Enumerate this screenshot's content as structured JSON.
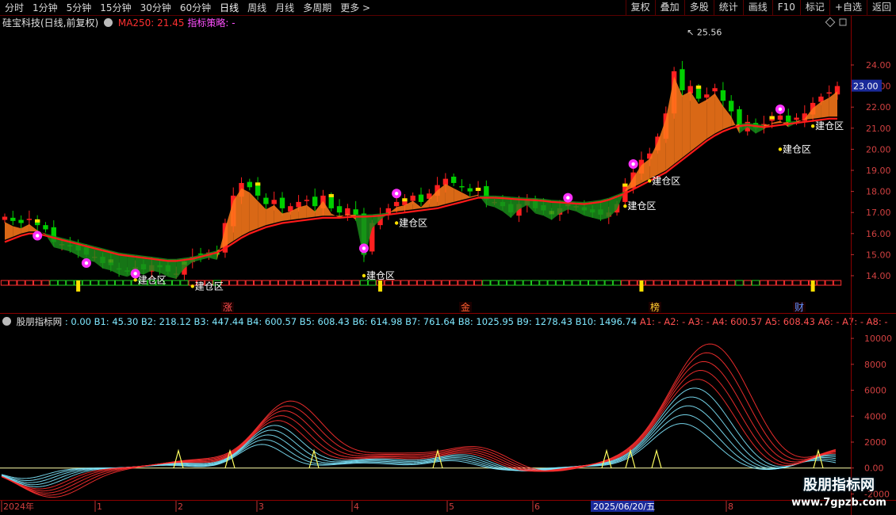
{
  "toolbar": {
    "periods": [
      "分时",
      "1分钟",
      "5分钟",
      "15分钟",
      "30分钟",
      "60分钟",
      "日线",
      "周线",
      "月线",
      "多周期",
      "更多"
    ],
    "active_period": "日线",
    "more_arrow": ">",
    "actions": [
      "复权",
      "叠加",
      "多股",
      "统计",
      "画线",
      "F10",
      "标记",
      "+自选",
      "返回"
    ]
  },
  "main_info": {
    "stock": "硅宝科技(日线,前复权)",
    "ma": "MA250: 21.45",
    "strategy": "指标策略: -"
  },
  "price_axis": {
    "ticks": [
      "24.00",
      "23.00",
      "22.00",
      "21.00",
      "20.00",
      "19.00",
      "18.00",
      "17.00",
      "16.00",
      "15.00",
      "14.00"
    ],
    "current_price": "23.00",
    "high_label": "25.56"
  },
  "signals": {
    "build_label": "建仓区",
    "bottom_marks": [
      "涨",
      "金",
      "榜",
      "财"
    ]
  },
  "indicator_info": {
    "title": "股朋指标网",
    "b_values": ": 0.00  B1: 45.30  B2: 218.12  B3: 447.44  B4: 600.57  B5: 608.43  B6: 614.98  B7: 761.64  B8: 1025.95  B9: 1278.43  B10: 1496.74",
    "a_values": "A1: -  A2: -  A3: -  A4: 600.57  A5: 608.43  A6: -  A7: -  A8: -"
  },
  "indicator_axis": {
    "ticks": [
      "10000",
      "8000",
      "6000",
      "4000",
      "2000",
      "0.00",
      "-2000"
    ]
  },
  "time_axis": {
    "labels": [
      "2024年",
      "1",
      "2",
      "3",
      "4",
      "5",
      "6",
      "8"
    ],
    "cursor_date": "2025/06/20/五"
  },
  "watermark": {
    "line1": "股朋指标网",
    "line2": "www.7gpzb.com"
  },
  "colors": {
    "up": "#ff2020",
    "down": "#00d000",
    "ma_line": "#ff1a1a",
    "band_up": "#ff7a1a",
    "band_down": "#1a8a1a",
    "axis_text": "#d04040"
  },
  "chart_data": {
    "type": "candlestick",
    "price_ylim": [
      13.2,
      25.9
    ],
    "ma250_last": 21.45,
    "indicator_ylim": [
      -2400,
      10800
    ],
    "close": [
      16.8,
      16.6,
      16.5,
      16.7,
      16.4,
      16.2,
      15.6,
      15.5,
      15.4,
      15.2,
      15.0,
      14.9,
      14.6,
      14.5,
      14.3,
      14.2,
      14.4,
      14.3,
      14.5,
      14.4,
      14.2,
      14.1,
      14.6,
      14.9,
      15.0,
      15.1,
      15.0,
      16.5,
      17.8,
      18.4,
      18.2,
      17.8,
      17.4,
      17.6,
      17.2,
      17.3,
      17.5,
      17.6,
      17.3,
      17.8,
      17.2,
      17.0,
      17.2,
      16.9,
      15.0,
      16.5,
      16.9,
      17.2,
      17.5,
      17.6,
      17.8,
      17.5,
      17.9,
      18.3,
      18.6,
      18.4,
      18.2,
      18.0,
      18.1,
      17.6,
      17.5,
      17.3,
      17.0,
      17.4,
      17.6,
      17.2,
      17.1,
      16.9,
      17.2,
      17.4,
      17.3,
      17.1,
      17.0,
      16.9,
      17.0,
      17.4,
      18.3,
      18.9,
      19.5,
      19.8,
      20.6,
      21.7,
      23.7,
      22.8,
      23.0,
      22.4,
      22.6,
      22.9,
      22.3,
      21.8,
      21.0,
      21.3,
      21.0,
      21.2,
      21.5,
      21.6,
      21.3,
      21.5,
      21.7,
      22.2,
      22.5,
      22.7,
      23.0
    ],
    "ma250": [
      15.6,
      15.75,
      15.9,
      16.0,
      16.0,
      15.9,
      15.8,
      15.7,
      15.6,
      15.5,
      15.4,
      15.3,
      15.2,
      15.1,
      15.0,
      14.95,
      14.9,
      14.85,
      14.8,
      14.75,
      14.7,
      14.7,
      14.75,
      14.8,
      14.9,
      15.0,
      15.1,
      15.3,
      15.55,
      15.8,
      16.0,
      16.15,
      16.3,
      16.4,
      16.5,
      16.55,
      16.6,
      16.65,
      16.7,
      16.75,
      16.75,
      16.75,
      16.78,
      16.8,
      16.8,
      16.82,
      16.85,
      16.9,
      16.95,
      17.0,
      17.05,
      17.1,
      17.15,
      17.2,
      17.3,
      17.4,
      17.5,
      17.6,
      17.7,
      17.7,
      17.7,
      17.68,
      17.65,
      17.62,
      17.6,
      17.58,
      17.55,
      17.5,
      17.48,
      17.45,
      17.42,
      17.4,
      17.45,
      17.5,
      17.6,
      17.75,
      17.9,
      18.1,
      18.3,
      18.5,
      18.7,
      18.9,
      19.2,
      19.5,
      19.8,
      20.1,
      20.4,
      20.65,
      20.85,
      21.0,
      21.1,
      21.15,
      21.1,
      21.05,
      21.1,
      21.15,
      21.2,
      21.25,
      21.3,
      21.35,
      21.4,
      21.45,
      21.45
    ],
    "indicator_peak": 9800,
    "date_cursor": "2025/06/20/五"
  }
}
